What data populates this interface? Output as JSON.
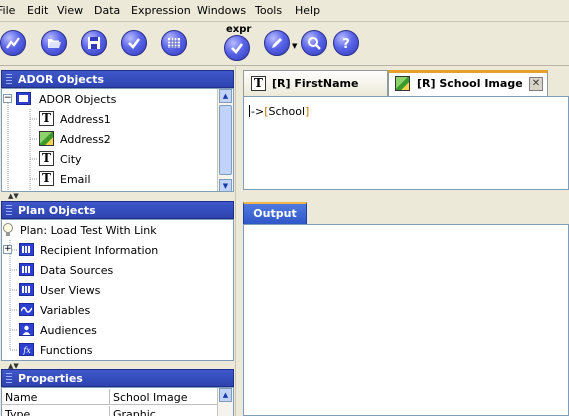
{
  "menu": [
    "File",
    "Edit",
    "View",
    "Data",
    "Expression",
    "Windows",
    "Tools",
    "Help"
  ],
  "toolbar": {
    "expr_label": "expr",
    "icons": [
      "chart-line-icon",
      "open-folder-icon",
      "save-disk-icon",
      "check-icon",
      "grid-icon",
      "expr-check-icon",
      "pencil-icon",
      "magnify-icon",
      "help-icon"
    ]
  },
  "ador_panel": {
    "title": "ADOR Objects",
    "root": "ADOR Objects",
    "items": [
      {
        "label": "Address1",
        "icon": "text-T-icon"
      },
      {
        "label": "Address2",
        "icon": "image-icon"
      },
      {
        "label": "City",
        "icon": "text-T-icon"
      },
      {
        "label": "Email",
        "icon": "text-T-icon"
      }
    ]
  },
  "plan_panel": {
    "title": "Plan Objects",
    "plan_label": "Plan: Load Test With Link",
    "items": [
      {
        "label": "Recipient Information",
        "icon": "table-icon"
      },
      {
        "label": "Data Sources",
        "icon": "table-icon"
      },
      {
        "label": "User Views",
        "icon": "table-icon"
      },
      {
        "label": "Variables",
        "icon": "wave-icon"
      },
      {
        "label": "Audiences",
        "icon": "person-icon"
      },
      {
        "label": "Functions",
        "icon": "fx-icon"
      }
    ]
  },
  "properties_panel": {
    "title": "Properties",
    "rows": [
      [
        "Name",
        "School Image"
      ],
      [
        "Type",
        "Graphic"
      ]
    ]
  },
  "tabs": [
    {
      "label": "[R] FirstName",
      "active": false
    },
    {
      "label": "[R] School Image",
      "active": true
    }
  ],
  "editor": {
    "prefix": "->",
    "field_open": "[",
    "field_name": "School",
    "field_close": "]"
  },
  "output_tab": "Output",
  "colors": {
    "panel_header": "#2d43b0",
    "active_tab_accent": "#e7a02b",
    "output_tab": "#2f57c8",
    "field_text": "#b87a00"
  }
}
